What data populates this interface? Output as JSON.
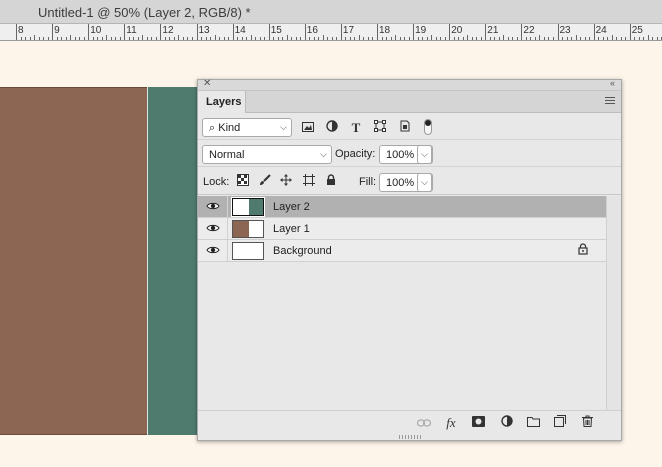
{
  "document": {
    "title": "Untitled-1 @ 50% (Layer 2, RGB/8) *"
  },
  "ruler": {
    "labels": [
      "8",
      "9",
      "10",
      "11",
      "12",
      "13",
      "14",
      "15",
      "16",
      "17",
      "18",
      "19",
      "20",
      "21",
      "22",
      "23",
      "24",
      "25"
    ]
  },
  "canvas": {
    "colors": {
      "background": "#fdf5e9",
      "layer1": "#8d6653",
      "layer2": "#4f7b6f"
    }
  },
  "panel": {
    "tab": "Layers",
    "filter": {
      "selected": "Kind",
      "icons": [
        "image-filter-icon",
        "adjustment-filter-icon",
        "type-filter-icon",
        "shape-filter-icon",
        "smart-object-filter-icon"
      ]
    },
    "blend_mode": "Normal",
    "opacity_label": "Opacity:",
    "opacity_value": "100%",
    "lock_label": "Lock:",
    "fill_label": "Fill:",
    "fill_value": "100%",
    "layers": [
      {
        "name": "Layer 2",
        "selected": true,
        "visible": true,
        "locked": false
      },
      {
        "name": "Layer 1",
        "selected": false,
        "visible": true,
        "locked": false
      },
      {
        "name": "Background",
        "selected": false,
        "visible": true,
        "locked": true
      }
    ],
    "footer_icons": [
      "link-layers-icon",
      "fx-icon",
      "mask-icon",
      "adjustment-layer-icon",
      "group-folder-icon",
      "new-layer-icon",
      "trash-icon"
    ]
  }
}
